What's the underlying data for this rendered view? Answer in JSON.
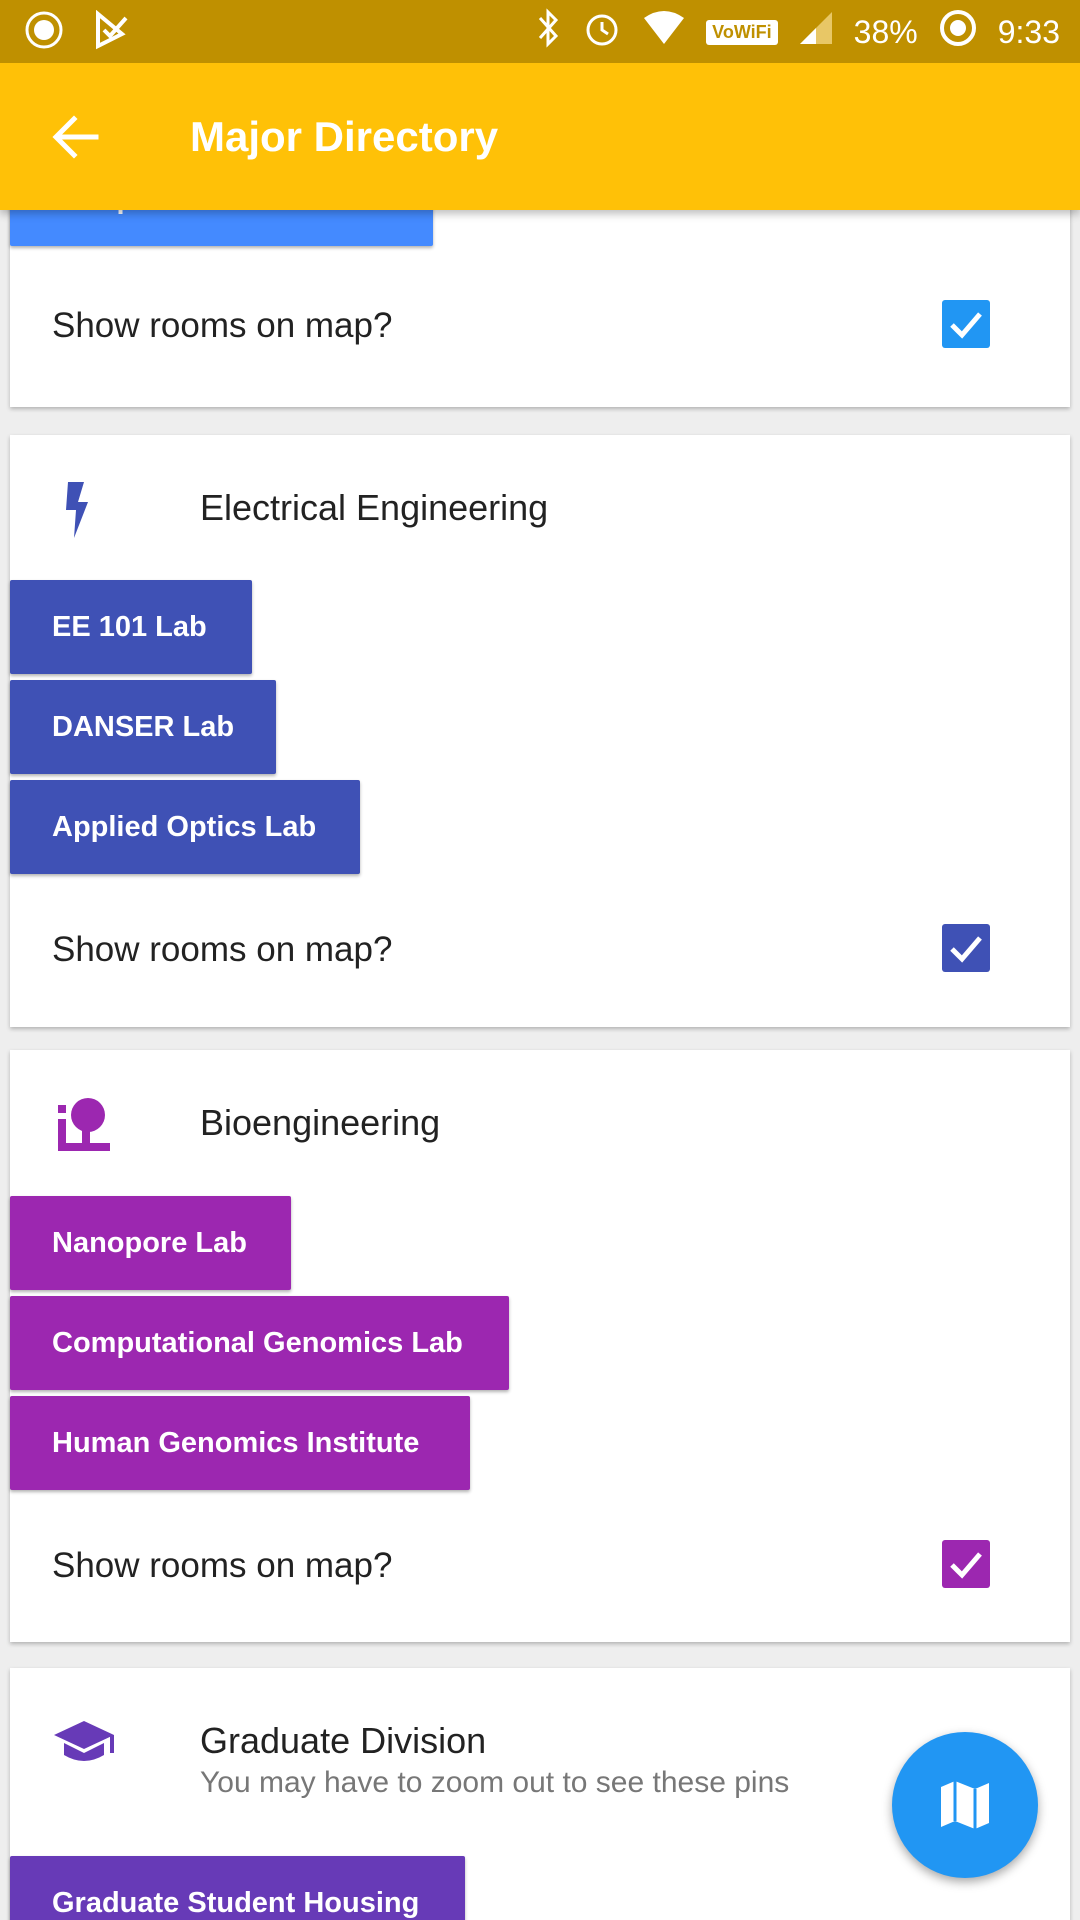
{
  "status_bar": {
    "battery": "38%",
    "time": "9:33",
    "wifi_badge": "VoWiFi"
  },
  "app_bar": {
    "title": "Major Directory"
  },
  "show_rooms_label": "Show rooms on map?",
  "sections": {
    "cs": {
      "labs": [
        "Computer Networks Lab"
      ],
      "show_rooms": true,
      "color": "#448aff"
    },
    "ee": {
      "name": "Electrical Engineering",
      "labs": [
        "EE 101 Lab",
        "DANSER Lab",
        "Applied Optics Lab"
      ],
      "show_rooms": true,
      "color": "#3f51b5",
      "icon": "lightning-icon"
    },
    "bio": {
      "name": "Bioengineering",
      "labs": [
        "Nanopore Lab",
        "Computational Genomics Lab",
        "Human Genomics Institute"
      ],
      "show_rooms": true,
      "color": "#9c27b0",
      "icon": "microscope-icon"
    },
    "grad": {
      "name": "Graduate Division",
      "subtitle": "You may have to zoom out to see these pins",
      "labs": [
        "Graduate Student Housing"
      ],
      "color": "#673ab7",
      "icon": "graduation-cap-icon"
    }
  },
  "fab": {
    "icon": "map-icon",
    "color": "#2196f3"
  }
}
